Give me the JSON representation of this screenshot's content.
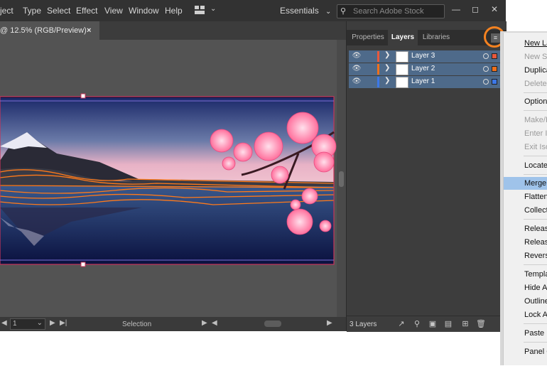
{
  "menubar": {
    "items": [
      "ject",
      "Type",
      "Select",
      "Effect",
      "View",
      "Window",
      "Help"
    ],
    "workspace": "Essentials",
    "search_placeholder": "Search Adobe Stock"
  },
  "document_tab": {
    "title": "@ 12.5% (RGB/Preview)",
    "close": "×"
  },
  "status": {
    "artboard_number": "1",
    "tool_label": "Selection"
  },
  "panel": {
    "tabs": [
      "Properties",
      "Layers",
      "Libraries"
    ],
    "active_tab": "Layers",
    "layers": [
      {
        "name": "Layer 3",
        "color": "#e8583c"
      },
      {
        "name": "Layer 2",
        "color": "#f0701a"
      },
      {
        "name": "Layer 1",
        "color": "#3c78e8"
      }
    ],
    "layer_count": "3 Layers"
  },
  "flyout": {
    "items": [
      {
        "label": "New La",
        "enabled": true,
        "highlighted": false
      },
      {
        "label": "New Su",
        "enabled": false,
        "highlighted": false
      },
      {
        "label": "Duplica",
        "enabled": true,
        "highlighted": false
      },
      {
        "label": "Delete",
        "enabled": false,
        "highlighted": false
      },
      {
        "label": "Option",
        "enabled": true,
        "highlighted": false
      },
      {
        "label": "Make/R",
        "enabled": false,
        "highlighted": false
      },
      {
        "label": "Enter Is",
        "enabled": false,
        "highlighted": false
      },
      {
        "label": "Exit Iso",
        "enabled": false,
        "highlighted": false
      },
      {
        "label": "Locate",
        "enabled": true,
        "highlighted": false
      },
      {
        "label": "Merge",
        "enabled": true,
        "highlighted": true
      },
      {
        "label": "Flatten",
        "enabled": true,
        "highlighted": false
      },
      {
        "label": "Collect",
        "enabled": true,
        "highlighted": false
      },
      {
        "label": "Release",
        "enabled": true,
        "highlighted": false
      },
      {
        "label": "Release",
        "enabled": true,
        "highlighted": false
      },
      {
        "label": "Reverse",
        "enabled": true,
        "highlighted": false
      },
      {
        "label": "Templa",
        "enabled": true,
        "highlighted": false
      },
      {
        "label": "Hide A",
        "enabled": true,
        "highlighted": false
      },
      {
        "label": "Outline",
        "enabled": true,
        "highlighted": false
      },
      {
        "label": "Lock A",
        "enabled": true,
        "highlighted": false
      },
      {
        "label": "Paste R",
        "enabled": true,
        "highlighted": false
      },
      {
        "label": "Panel O",
        "enabled": true,
        "highlighted": false
      }
    ]
  },
  "colors": {
    "accent_ring": "#f58220",
    "selection_row": "#4e6a8a",
    "menu_highlight": "#9fc3ea"
  }
}
